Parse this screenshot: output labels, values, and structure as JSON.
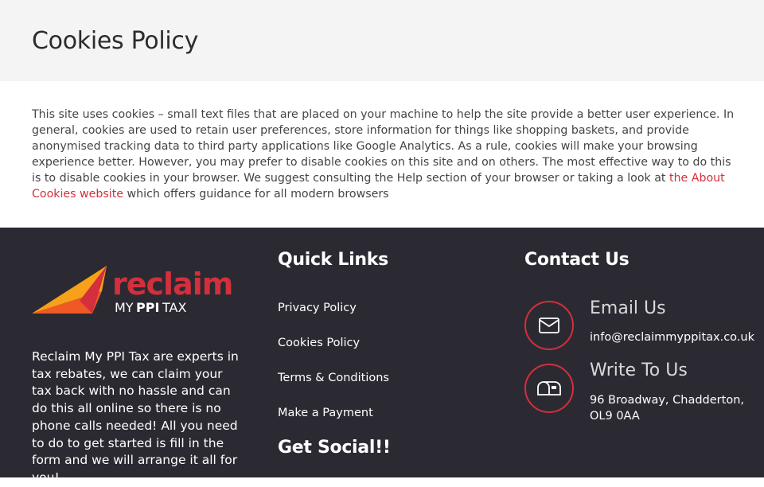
{
  "page": {
    "title": "Cookies Policy",
    "body_text_before_link": "This site uses cookies – small text files that are placed on your machine to help the site provide a better user experience. In general, cookies are used to retain user preferences, store information for things like shopping baskets, and provide anonymised tracking data to third party applications like Google Analytics. As a rule, cookies will make your browsing experience better. However, you may prefer to disable cookies on this site and on others. The most effective way to do this is to disable cookies in your browser. We suggest consulting the Help section of your browser or taking a look at ",
    "body_link_text": "the About Cookies website",
    "body_text_after_link": " which offers guidance for all modern browsers"
  },
  "footer": {
    "logo": {
      "word": "reclaim",
      "sub_my": "MY",
      "sub_ppi": "PPI",
      "sub_tax": "TAX"
    },
    "about_text": "Reclaim My PPI Tax are experts in tax rebates, we can claim your tax back with no hassle and can do this all online so there is no phone calls needed! All you need to do to get started is fill in the form and we will arrange it all for you!",
    "quick_links": {
      "heading": "Quick Links",
      "items": [
        {
          "label": "Privacy Policy"
        },
        {
          "label": "Cookies Policy"
        },
        {
          "label": "Terms & Conditions"
        },
        {
          "label": "Make a Payment"
        }
      ]
    },
    "social": {
      "heading": "Get Social!!"
    },
    "contact": {
      "heading": "Contact Us",
      "email_title": "Email Us",
      "email_value": "info@reclaimmyppitax.co.uk",
      "write_title": "Write To Us",
      "address_line1": "96 Broadway, Chadderton,",
      "address_line2": "OL9 0AA"
    }
  },
  "colors": {
    "accent": "#d32f3c",
    "footer_bg": "#2b2a33",
    "title_bar_bg": "#f4f4f4"
  },
  "icons": {
    "email": "envelope-icon",
    "address": "mailbox-icon"
  }
}
